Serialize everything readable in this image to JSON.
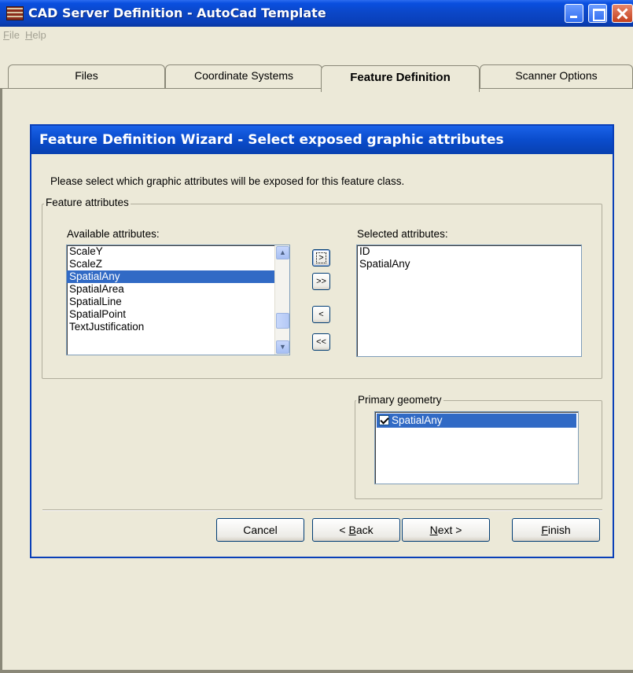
{
  "window": {
    "title": "CAD Server Definition - AutoCad Template"
  },
  "menu": {
    "file": {
      "mnemonic": "F",
      "rest": "ile"
    },
    "help": {
      "mnemonic": "H",
      "rest": "elp"
    }
  },
  "tabs": [
    {
      "label": "Files"
    },
    {
      "label": "Coordinate Systems"
    },
    {
      "label": "Feature Definition"
    },
    {
      "label": "Scanner Options"
    }
  ],
  "active_tab": "Feature Definition",
  "wizard": {
    "title": "Feature Definition Wizard - Select exposed graphic attributes",
    "instruction": "Please select which graphic attributes will be exposed for this feature class.",
    "feature_attributes_label": "Feature attributes",
    "available_label": "Available attributes:",
    "available_items": [
      "ScaleY",
      "ScaleZ",
      "SpatialAny",
      "SpatialArea",
      "SpatialLine",
      "SpatialPoint",
      "TextJustification"
    ],
    "available_selected": "SpatialAny",
    "selected_label": "Selected attributes:",
    "selected_items": [
      "ID",
      "SpatialAny"
    ],
    "move_buttons": {
      "add": ">",
      "add_all": ">>",
      "remove": "<",
      "remove_all": "<<"
    },
    "primary_geometry_label": "Primary geometry",
    "primary_geometry_item": {
      "label": "SpatialAny",
      "checked": true
    },
    "buttons": {
      "cancel": "Cancel",
      "back": {
        "prefix": "< ",
        "mnemonic": "B",
        "rest": "ack"
      },
      "next": {
        "mnemonic": "N",
        "rest": "ext >"
      },
      "finish": {
        "mnemonic": "F",
        "rest": "inish"
      }
    }
  },
  "colors": {
    "titlebar": "#0a4fe0",
    "selection": "#316ac5",
    "dialog_bg": "#ece9d8"
  },
  "icons": [
    "app-icon",
    "minimize-icon",
    "maximize-icon",
    "close-icon",
    "scroll-up-icon",
    "scroll-down-icon",
    "checkbox-checked-icon"
  ]
}
